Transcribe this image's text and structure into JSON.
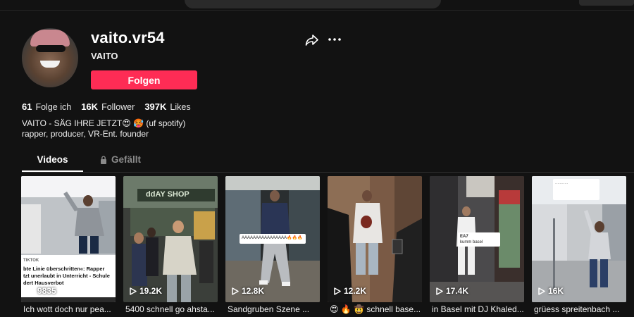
{
  "profile": {
    "username": "vaito.vr54",
    "nickname": "VAITO",
    "follow_label": "Folgen",
    "stats": [
      {
        "value": "61",
        "label": "Folge ich"
      },
      {
        "value": "16K",
        "label": "Follower"
      },
      {
        "value": "397K",
        "label": "Likes"
      }
    ],
    "bio_line1": "VAITO - SÄG IHRE JETZT😍 🥵  (uf spotify)",
    "bio_line2": "rapper, producer, VR-Ent. founder"
  },
  "tabs": {
    "videos": "Videos",
    "liked": "Gefällt"
  },
  "videos": [
    {
      "views": "9835",
      "caption": "Ich wott doch nur pea...",
      "overlay_source": "TIKTOK",
      "overlay_lines": [
        "bte Linie überschritten«: Rapper",
        "tzt unerlaubt in Unterricht - Schule",
        "dert Hausverbot"
      ]
    },
    {
      "views": "19.2K",
      "caption": "5400 schnell go ahsta...",
      "sign": "ddAY SHOP"
    },
    {
      "views": "12.8K",
      "caption": "Sandgruben Szene ..."
    },
    {
      "views": "12.2K",
      "caption": "😍 🔥 🤠  schnell base..."
    },
    {
      "views": "17.4K",
      "caption": "in Basel mit DJ Khaled...",
      "sticker_name": "EA7",
      "sticker_text": "kumm basel"
    },
    {
      "views": "16K",
      "caption": "grüess spreitenbach ..."
    }
  ],
  "colors": {
    "background": "#121212",
    "accent": "#fe2c55",
    "muted": "#8a8a8a"
  },
  "icons": [
    "search-icon",
    "share-icon",
    "more-icon",
    "lock-icon",
    "play-icon"
  ]
}
